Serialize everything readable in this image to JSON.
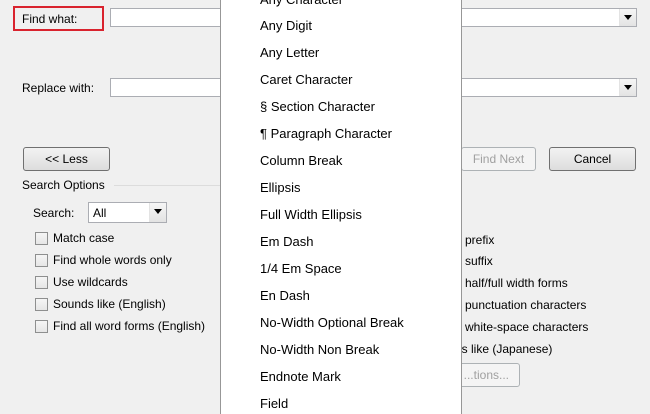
{
  "find": {
    "label": "Find what:",
    "value": ""
  },
  "replace": {
    "label": "Replace with:",
    "value": ""
  },
  "buttons": {
    "less": "<< Less",
    "find_next": "Find Next",
    "cancel": "Cancel",
    "options": "...tions..."
  },
  "search_options": {
    "title": "Search Options",
    "search_label": "Search:",
    "search_value": "All",
    "left_checks": [
      "Match case",
      "Find whole words only",
      "Use wildcards",
      "Sounds like (English)",
      "Find all word forms (English)"
    ],
    "right_checks": [
      "n prefix",
      "n suffix",
      "h half/full width forms",
      "e punctuation characters",
      "e white-space characters",
      "ds like (Japanese)"
    ]
  },
  "menu": {
    "items": [
      "Any Character",
      "Any Digit",
      "Any Letter",
      "Caret Character",
      "§ Section Character",
      "¶ Paragraph Character",
      "Column Break",
      "Ellipsis",
      "Full Width Ellipsis",
      "Em Dash",
      "1/4 Em Space",
      "En Dash",
      "No-Width Optional Break",
      "No-Width Non Break",
      "Endnote Mark",
      "Field"
    ]
  },
  "colors": {
    "highlight": "#d9232e",
    "dialog_bg": "#f0f0f0",
    "menu_bg": "#ffffff"
  }
}
